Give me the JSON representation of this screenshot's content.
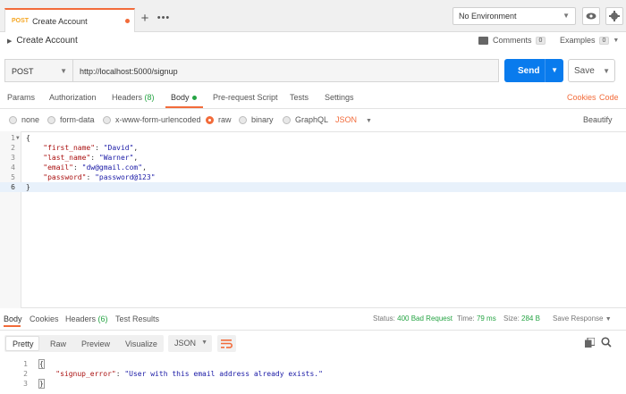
{
  "tabbar": {
    "tab_method": "POST",
    "tab_name": "Create Account",
    "plus": "+",
    "more": "•••"
  },
  "environment": {
    "selected": "No Environment"
  },
  "request": {
    "title": "Create Account",
    "comments_label": "Comments",
    "comments_count": "0",
    "examples_label": "Examples",
    "examples_count": "0",
    "method": "POST",
    "url": "http://localhost:5000/signup",
    "send_label": "Send",
    "save_label": "Save"
  },
  "request_tabs": {
    "params": "Params",
    "authorization": "Authorization",
    "headers": "Headers",
    "headers_count": "(8)",
    "body": "Body",
    "prerequest": "Pre-request Script",
    "tests": "Tests",
    "settings": "Settings",
    "cookies": "Cookies",
    "code": "Code"
  },
  "body_options": {
    "none": "none",
    "form_data": "form-data",
    "urlencoded": "x-www-form-urlencoded",
    "raw": "raw",
    "binary": "binary",
    "graphql": "GraphQL",
    "format": "JSON",
    "beautify": "Beautify"
  },
  "request_body": {
    "line_numbers": [
      "1",
      "2",
      "3",
      "4",
      "5",
      "6"
    ],
    "lines": [
      {
        "pre": "{",
        "key": "",
        "sep": "",
        "val": "",
        "post": ""
      },
      {
        "pre": "    ",
        "key": "\"first_name\"",
        "sep": ": ",
        "val": "\"David\"",
        "post": ","
      },
      {
        "pre": "    ",
        "key": "\"last_name\"",
        "sep": ": ",
        "val": "\"Warner\"",
        "post": ","
      },
      {
        "pre": "    ",
        "key": "\"email\"",
        "sep": ": ",
        "val": "\"dw@gmail.com\"",
        "post": ","
      },
      {
        "pre": "    ",
        "key": "\"password\"",
        "sep": ": ",
        "val": "\"password@123\"",
        "post": ""
      },
      {
        "pre": "}",
        "key": "",
        "sep": "",
        "val": "",
        "post": ""
      }
    ]
  },
  "response_tabs": {
    "body": "Body",
    "cookies": "Cookies",
    "headers": "Headers",
    "headers_count": "(6)",
    "test_results": "Test Results"
  },
  "response_status": {
    "status_label": "Status:",
    "status_value": "400 Bad Request",
    "time_label": "Time:",
    "time_value": "79 ms",
    "size_label": "Size:",
    "size_value": "284 B",
    "save_response": "Save Response"
  },
  "response_toolbar": {
    "pretty": "Pretty",
    "raw": "Raw",
    "preview": "Preview",
    "visualize": "Visualize",
    "format": "JSON"
  },
  "response_body": {
    "line_numbers": [
      "1",
      "2",
      "3"
    ],
    "line1": "{",
    "line2_key": "\"signup_error\"",
    "line2_sep": ": ",
    "line2_val": "\"User with this email address already exists.\"",
    "line3": "}"
  },
  "colors": {
    "accent": "#f26b3a",
    "send_button": "#097bed",
    "status_error": "#26a444"
  }
}
